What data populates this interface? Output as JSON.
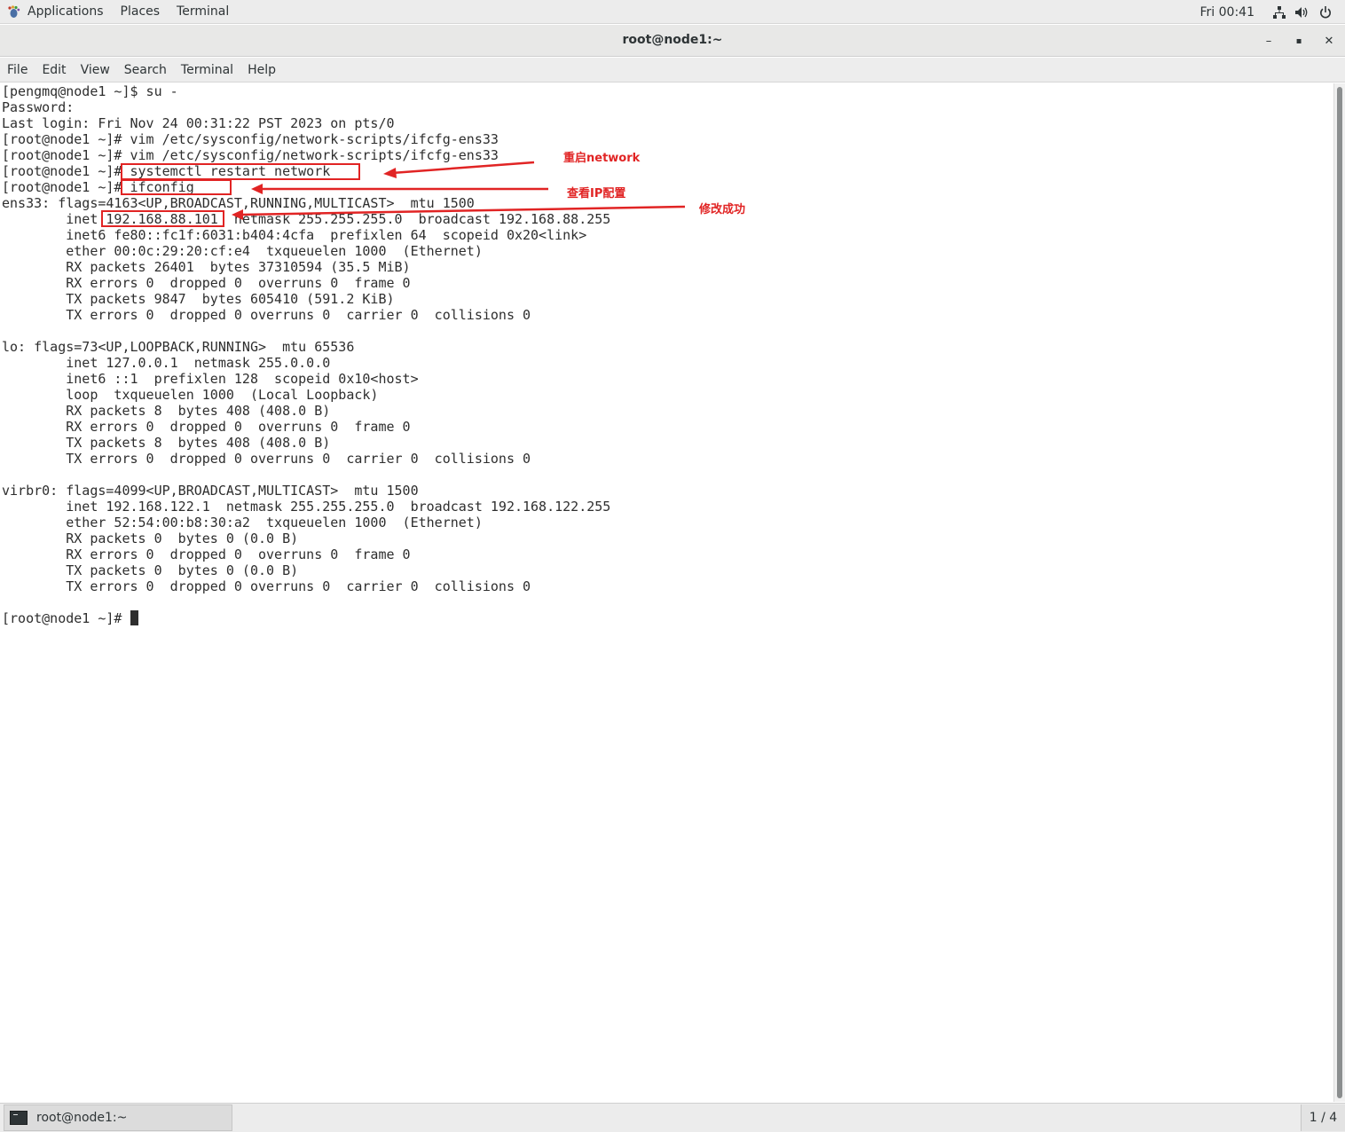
{
  "top_panel": {
    "applications": "Applications",
    "places": "Places",
    "terminal": "Terminal",
    "clock": "Fri 00:41",
    "icons": [
      "network-icon",
      "volume-icon",
      "power-icon"
    ]
  },
  "window": {
    "title": "root@node1:~",
    "minimize": "–",
    "maximize": "▪",
    "close": "✕"
  },
  "menu": {
    "file": "File",
    "edit": "Edit",
    "view": "View",
    "search": "Search",
    "terminal": "Terminal",
    "help": "Help"
  },
  "terminal": {
    "lines": [
      "[pengmq@node1 ~]$ su -",
      "Password:",
      "Last login: Fri Nov 24 00:31:22 PST 2023 on pts/0",
      "[root@node1 ~]# vim /etc/sysconfig/network-scripts/ifcfg-ens33",
      "[root@node1 ~]# vim /etc/sysconfig/network-scripts/ifcfg-ens33",
      "[root@node1 ~]# systemctl restart network",
      "[root@node1 ~]# ifconfig",
      "ens33: flags=4163<UP,BROADCAST,RUNNING,MULTICAST>  mtu 1500",
      "        inet 192.168.88.101  netmask 255.255.255.0  broadcast 192.168.88.255",
      "        inet6 fe80::fc1f:6031:b404:4cfa  prefixlen 64  scopeid 0x20<link>",
      "        ether 00:0c:29:20:cf:e4  txqueuelen 1000  (Ethernet)",
      "        RX packets 26401  bytes 37310594 (35.5 MiB)",
      "        RX errors 0  dropped 0  overruns 0  frame 0",
      "        TX packets 9847  bytes 605410 (591.2 KiB)",
      "        TX errors 0  dropped 0 overruns 0  carrier 0  collisions 0",
      "",
      "lo: flags=73<UP,LOOPBACK,RUNNING>  mtu 65536",
      "        inet 127.0.0.1  netmask 255.0.0.0",
      "        inet6 ::1  prefixlen 128  scopeid 0x10<host>",
      "        loop  txqueuelen 1000  (Local Loopback)",
      "        RX packets 8  bytes 408 (408.0 B)",
      "        RX errors 0  dropped 0  overruns 0  frame 0",
      "        TX packets 8  bytes 408 (408.0 B)",
      "        TX errors 0  dropped 0 overruns 0  carrier 0  collisions 0",
      "",
      "virbr0: flags=4099<UP,BROADCAST,MULTICAST>  mtu 1500",
      "        inet 192.168.122.1  netmask 255.255.255.0  broadcast 192.168.122.255",
      "        ether 52:54:00:b8:30:a2  txqueuelen 1000  (Ethernet)",
      "        RX packets 0  bytes 0 (0.0 B)",
      "        RX errors 0  dropped 0  overruns 0  frame 0",
      "        TX packets 0  bytes 0 (0.0 B)",
      "        TX errors 0  dropped 0 overruns 0  carrier 0  collisions 0",
      ""
    ],
    "prompt": "[root@node1 ~]# "
  },
  "annotations": {
    "restart_label": "重启network",
    "ifconfig_label": "查看IP配置",
    "success_label": "修改成功",
    "color": "#e12424"
  },
  "taskbar": {
    "item": "root@node1:~",
    "workspace": "1 / 4"
  }
}
